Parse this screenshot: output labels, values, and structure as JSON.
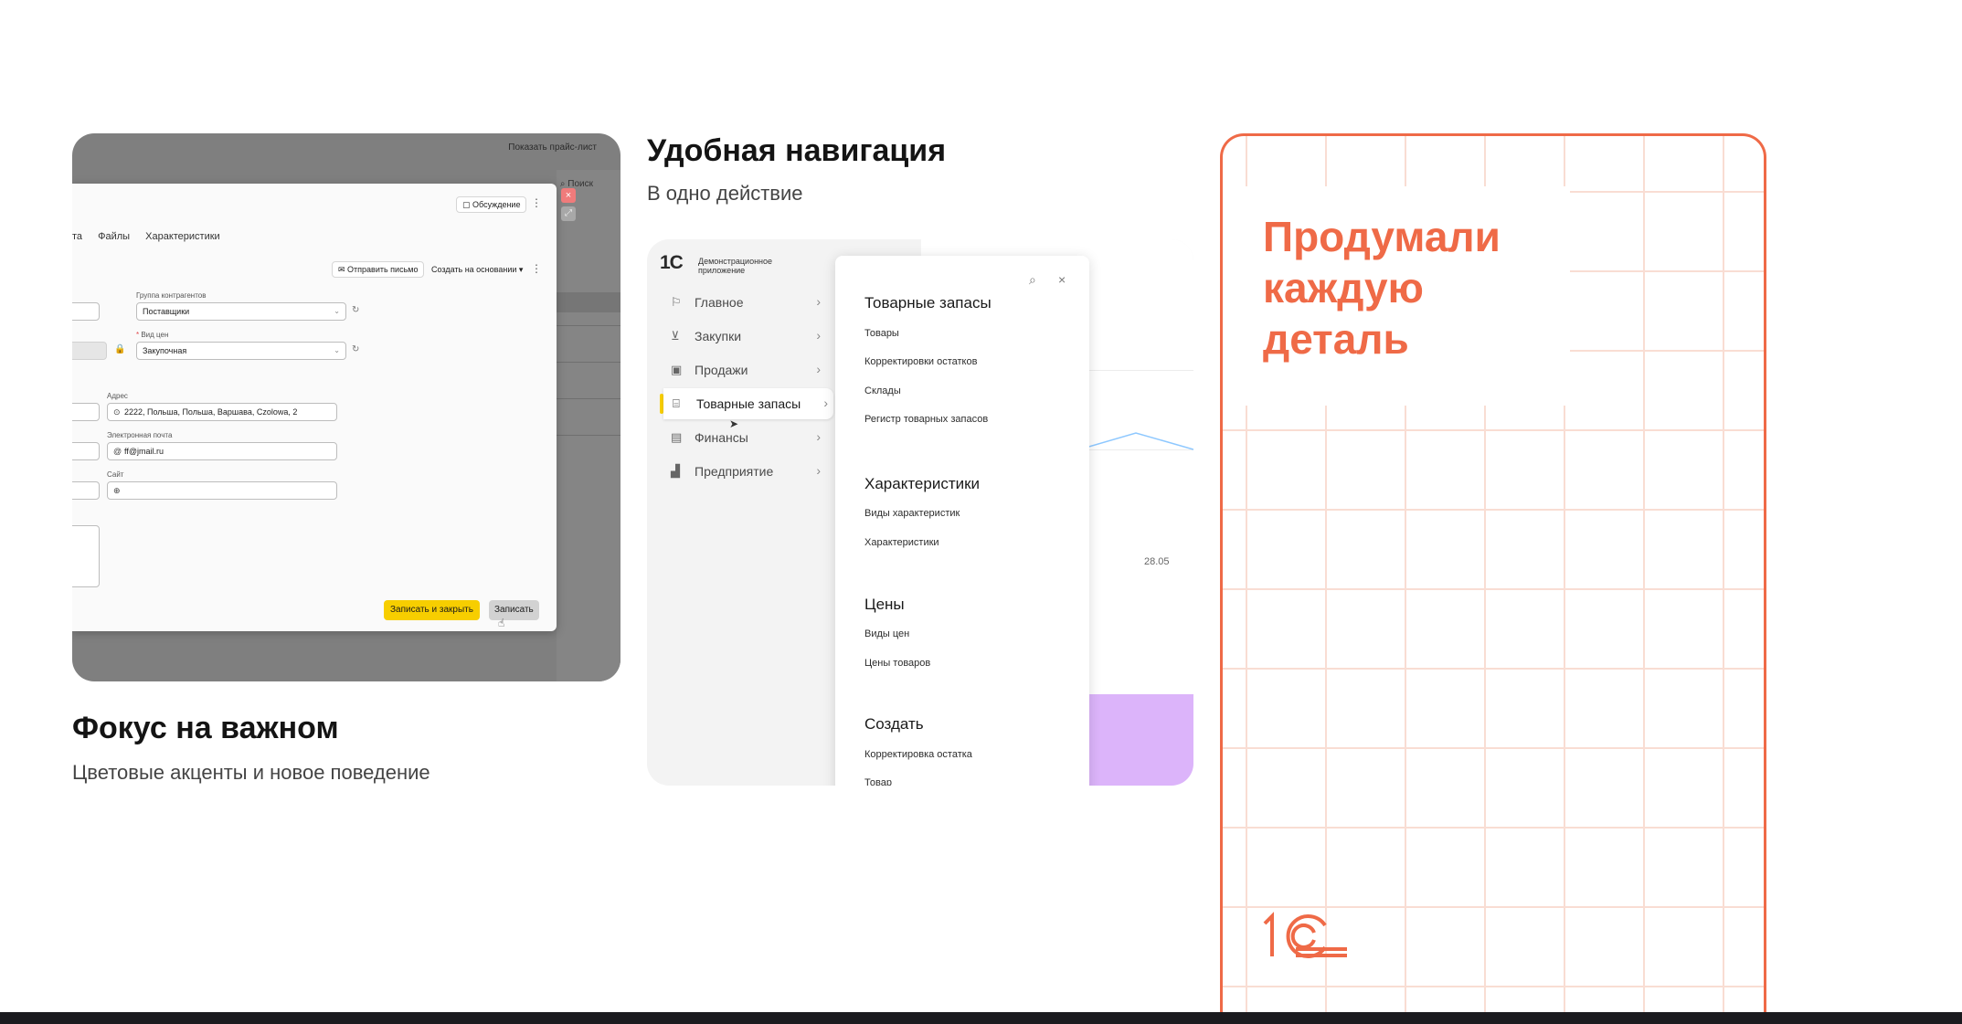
{
  "focus_card": {
    "screenshot": {
      "top_link": "Показать прайс-лист",
      "search_hint": "Поиск",
      "discussion_button": "Обсуждение",
      "tabs": [
        "та",
        "Файлы",
        "Характеристики"
      ],
      "send_letter_button": "Отправить письмо",
      "create_based_button": "Создать на основании",
      "group_label": "Группа контрагентов",
      "group_value": "Поставщики",
      "price_type_label": "Вид цен",
      "price_type_value": "Закупочная",
      "address_label": "Адрес",
      "address_value": "2222, Польша, Польша, Варшава, Czolowa, 2",
      "email_label": "Электронная почта",
      "email_value": "ff@jmail.ru",
      "site_label": "Сайт",
      "site_value": "",
      "save_close_button": "Записать и закрыть",
      "save_button": "Записать"
    },
    "title": "Фокус на важном",
    "subtitle": "Цветовые акценты и новое поведение"
  },
  "nav_card": {
    "title": "Удобная навигация",
    "subtitle": "В одно действие",
    "app": {
      "logo_text": "1С",
      "caption": "Демонстрационное приложение"
    },
    "menu": [
      {
        "label": "Главное",
        "icon": "flag-icon"
      },
      {
        "label": "Закупки",
        "icon": "cart-icon"
      },
      {
        "label": "Продажи",
        "icon": "bag-icon"
      },
      {
        "label": "Товарные запасы",
        "icon": "warehouse-icon",
        "active": true
      },
      {
        "label": "Финансы",
        "icon": "wallet-icon"
      },
      {
        "label": "Предприятие",
        "icon": "factory-icon"
      }
    ],
    "chart_date": "28.05",
    "chart_date_partial": "5",
    "panel": {
      "sections": [
        {
          "title": "Товарные запасы",
          "links": [
            "Товары",
            "Корректировки остатков",
            "Склады",
            "Регистр товарных запасов"
          ]
        },
        {
          "title": "Характеристики",
          "links": [
            "Виды характеристик",
            "Характеристики"
          ]
        },
        {
          "title": "Цены",
          "links": [
            "Виды цен",
            "Цены товаров"
          ]
        },
        {
          "title": "Создать",
          "links": [
            "Корректировка остатка",
            "Товар"
          ]
        }
      ]
    }
  },
  "brand_card": {
    "headline": "Продумали каждую деталь",
    "logo_text": "1С",
    "accent_color": "#ef6a47"
  },
  "colors": {
    "primary_button": "#f7ce00",
    "accent_purple": "#dcb4fa"
  }
}
